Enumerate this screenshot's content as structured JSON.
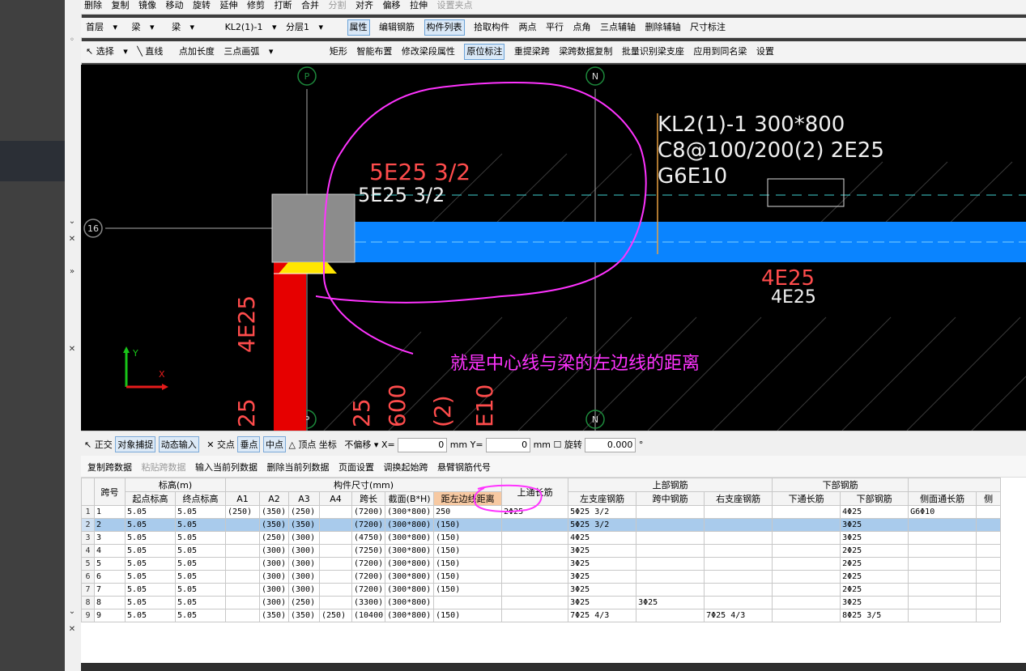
{
  "toolbar1": {
    "items": [
      "删除",
      "复制",
      "镜像",
      "移动",
      "旋转",
      "延伸",
      "修剪",
      "打断",
      "合并",
      "分割",
      "对齐",
      "偏移",
      "拉伸",
      "设置夹点"
    ]
  },
  "toolbar2": {
    "floor": "首层",
    "category": "梁",
    "type": "梁",
    "component": "KL2(1)-1",
    "layer": "分层1",
    "items": [
      "属性",
      "编辑钢筋",
      "构件列表",
      "拾取构件",
      "两点",
      "平行",
      "点角",
      "三点辅轴",
      "删除辅轴",
      "尺寸标注"
    ]
  },
  "toolbar3": {
    "items": [
      "选择",
      "直线",
      "点加长度",
      "三点画弧",
      "矩形",
      "智能布置",
      "修改梁段属性",
      "原位标注",
      "重提梁跨",
      "梁跨数据复制",
      "批量识别梁支座",
      "应用到同名梁",
      "设置"
    ]
  },
  "canvas": {
    "axis_labels": [
      "P",
      "N",
      "16",
      "P",
      "N"
    ],
    "beam_annot_line1": "KL2(1)-1  300*800",
    "beam_annot_line2": "C8@100/200(2)  2E25",
    "beam_annot_line3": "G6E10",
    "top_rebar_red": "5E25 3/2",
    "top_rebar_white": "5E25 3/2",
    "bottom_rebar_red": "4E25",
    "bottom_rebar_white": "4E25",
    "col_text1": "4E25",
    "col_text2": "25",
    "col_text3": "25",
    "col_text4": "600",
    "col_text5": "(2)",
    "col_text6": "E10",
    "annotation_note": "就是中心线与梁的左边线的距离",
    "axis_y": "Y",
    "axis_x": "X",
    "colors": {
      "beam": "#0a84ff",
      "column": "#e60000",
      "note": "#ff33ff",
      "red_text": "#ff4c4c"
    }
  },
  "statusbar": {
    "items": [
      "正交",
      "对象捕捉",
      "动态输入",
      "交点",
      "垂点",
      "中点",
      "顶点",
      "坐标",
      "不偏移"
    ],
    "x_label": "X=",
    "x_value": "0",
    "x_unit": "mm",
    "y_label": "Y=",
    "y_value": "0",
    "y_unit": "mm",
    "rotate_label": "旋转",
    "rotate_value": "0.000",
    "deg": "°"
  },
  "table_toolbar": {
    "items": [
      "复制跨数据",
      "粘贴跨数据",
      "输入当前列数据",
      "删除当前列数据",
      "页面设置",
      "调换起始跨",
      "悬臂钢筋代号"
    ]
  },
  "grid": {
    "headers_top": {
      "span": "跨号",
      "elev": "标高(m)",
      "dims": "构件尺寸(mm)",
      "top_long": "上通长筋",
      "top_rebar": "上部钢筋",
      "bot_rebar": "下部钢筋"
    },
    "headers_sub": [
      "起点标高",
      "终点标高",
      "A1",
      "A2",
      "A3",
      "A4",
      "跨长",
      "截面(B*H)",
      "距左边线距离",
      "左支座钢筋",
      "跨中钢筋",
      "右支座钢筋",
      "下通长筋",
      "下部钢筋",
      "侧面通长筋",
      "侧"
    ],
    "rows": [
      [
        "1",
        "1",
        "5.05",
        "5.05",
        "(250)",
        "(350)",
        "(250)",
        "",
        "(7200)",
        "(300*800)",
        "250",
        "2Φ25",
        "5Φ25 3/2",
        "",
        "",
        "",
        "4Φ25",
        "G6Φ10",
        ""
      ],
      [
        "2",
        "2",
        "5.05",
        "5.05",
        "",
        "(350)",
        "(350)",
        "",
        "(7200)",
        "(300*800)",
        "(150)",
        "",
        "5Φ25 3/2",
        "",
        "",
        "",
        "3Φ25",
        "",
        ""
      ],
      [
        "3",
        "3",
        "5.05",
        "5.05",
        "",
        "(250)",
        "(300)",
        "",
        "(4750)",
        "(300*800)",
        "(150)",
        "",
        "4Φ25",
        "",
        "",
        "",
        "3Φ25",
        "",
        ""
      ],
      [
        "4",
        "4",
        "5.05",
        "5.05",
        "",
        "(300)",
        "(300)",
        "",
        "(7250)",
        "(300*800)",
        "(150)",
        "",
        "3Φ25",
        "",
        "",
        "",
        "2Φ25",
        "",
        ""
      ],
      [
        "5",
        "5",
        "5.05",
        "5.05",
        "",
        "(300)",
        "(300)",
        "",
        "(7200)",
        "(300*800)",
        "(150)",
        "",
        "3Φ25",
        "",
        "",
        "",
        "2Φ25",
        "",
        ""
      ],
      [
        "6",
        "6",
        "5.05",
        "5.05",
        "",
        "(300)",
        "(300)",
        "",
        "(7200)",
        "(300*800)",
        "(150)",
        "",
        "3Φ25",
        "",
        "",
        "",
        "2Φ25",
        "",
        ""
      ],
      [
        "7",
        "7",
        "5.05",
        "5.05",
        "",
        "(300)",
        "(300)",
        "",
        "(7200)",
        "(300*800)",
        "(150)",
        "",
        "3Φ25",
        "",
        "",
        "",
        "2Φ25",
        "",
        ""
      ],
      [
        "8",
        "8",
        "5.05",
        "5.05",
        "",
        "(300)",
        "(250)",
        "",
        "(3300)",
        "(300*800)",
        "",
        "",
        "3Φ25",
        "3Φ25",
        "",
        "",
        "3Φ25",
        "",
        ""
      ],
      [
        "9",
        "9",
        "5.05",
        "5.05",
        "",
        "(350)",
        "(350)",
        "(250)",
        "(10400",
        "(300*800)",
        "(150)",
        "",
        "7Φ25 4/3",
        "",
        "7Φ25 4/3",
        "",
        "8Φ25 3/5",
        "",
        ""
      ]
    ]
  }
}
